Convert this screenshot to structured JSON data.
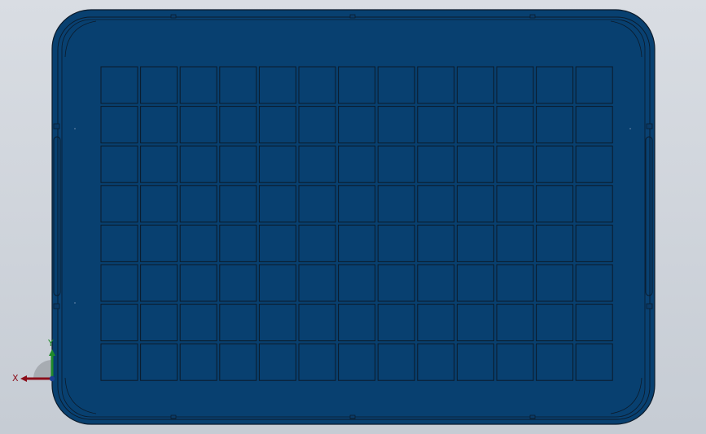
{
  "viewport": {
    "background_top": "#d9dde3",
    "background_bottom": "#c6ccd4"
  },
  "part": {
    "description_hidden": "",
    "face_color": "#084070",
    "edge_color": "#0b1a2a",
    "grid": {
      "rows": 8,
      "columns": 13
    }
  },
  "triad": {
    "x_label": "X",
    "y_label": "Y",
    "x_color": "#8b0d1a",
    "y_color": "#1f8a2a",
    "z_color": "#1c3f8f"
  }
}
